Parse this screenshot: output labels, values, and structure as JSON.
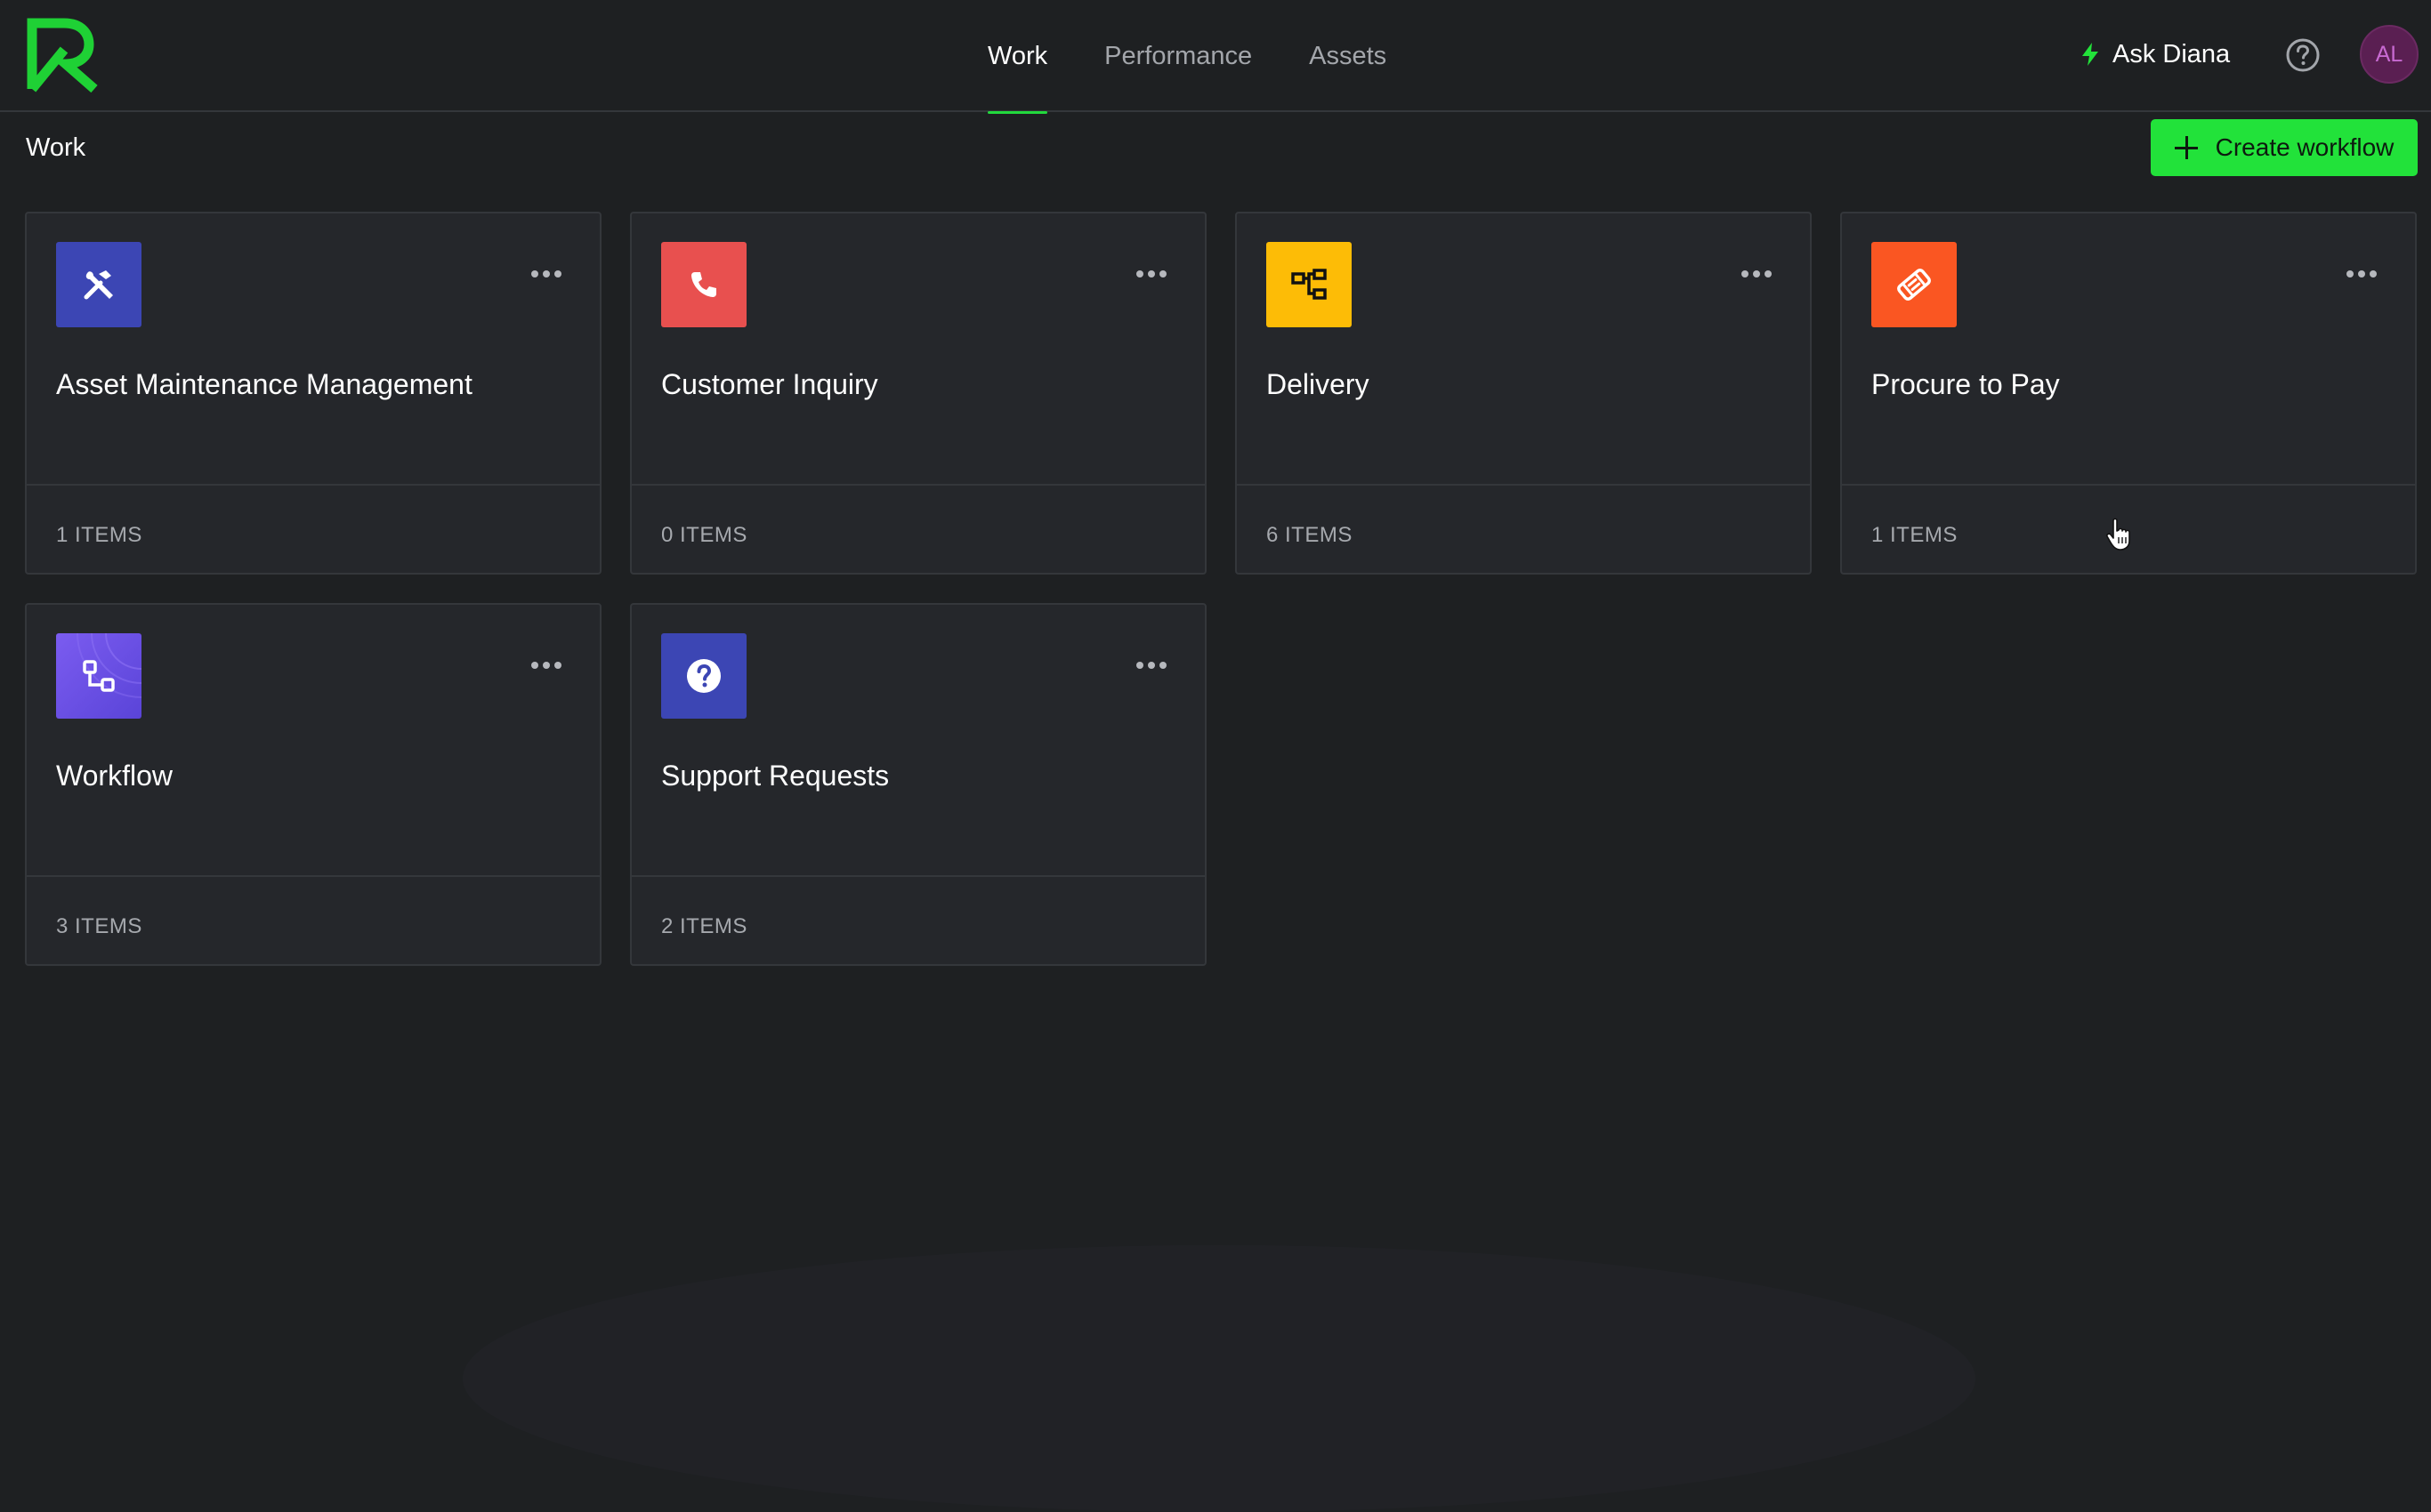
{
  "app": {
    "logo_icon": "brand-r-logo-icon",
    "accent_color": "#22e23a"
  },
  "nav": {
    "tabs": [
      {
        "label": "Work",
        "active": true
      },
      {
        "label": "Performance",
        "active": false
      },
      {
        "label": "Assets",
        "active": false
      }
    ]
  },
  "header": {
    "ask_label": "Ask Diana",
    "ask_icon": "lightning-bolt-icon",
    "help_icon": "question-circle-icon",
    "avatar_initials": "AL"
  },
  "page": {
    "title": "Work",
    "create_label": "Create workflow"
  },
  "cards": [
    {
      "title": "Asset Maintenance Management",
      "count": "1 ITEMS",
      "icon": "tools-icon",
      "color": "#3c46b4"
    },
    {
      "title": "Customer Inquiry",
      "count": "0 ITEMS",
      "icon": "phone-icon",
      "color": "#e8504f"
    },
    {
      "title": "Delivery",
      "count": "6 ITEMS",
      "icon": "org-chart-icon",
      "color": "#fdbc06"
    },
    {
      "title": "Procure to Pay",
      "count": "1 ITEMS",
      "icon": "handshake-icon",
      "color": "#fa5622"
    },
    {
      "title": "Workflow",
      "count": "3 ITEMS",
      "icon": "workflow-icon",
      "color": "#6a4ee6"
    },
    {
      "title": "Support Requests",
      "count": "2 ITEMS",
      "icon": "question-icon",
      "color": "#3c46b4"
    }
  ]
}
